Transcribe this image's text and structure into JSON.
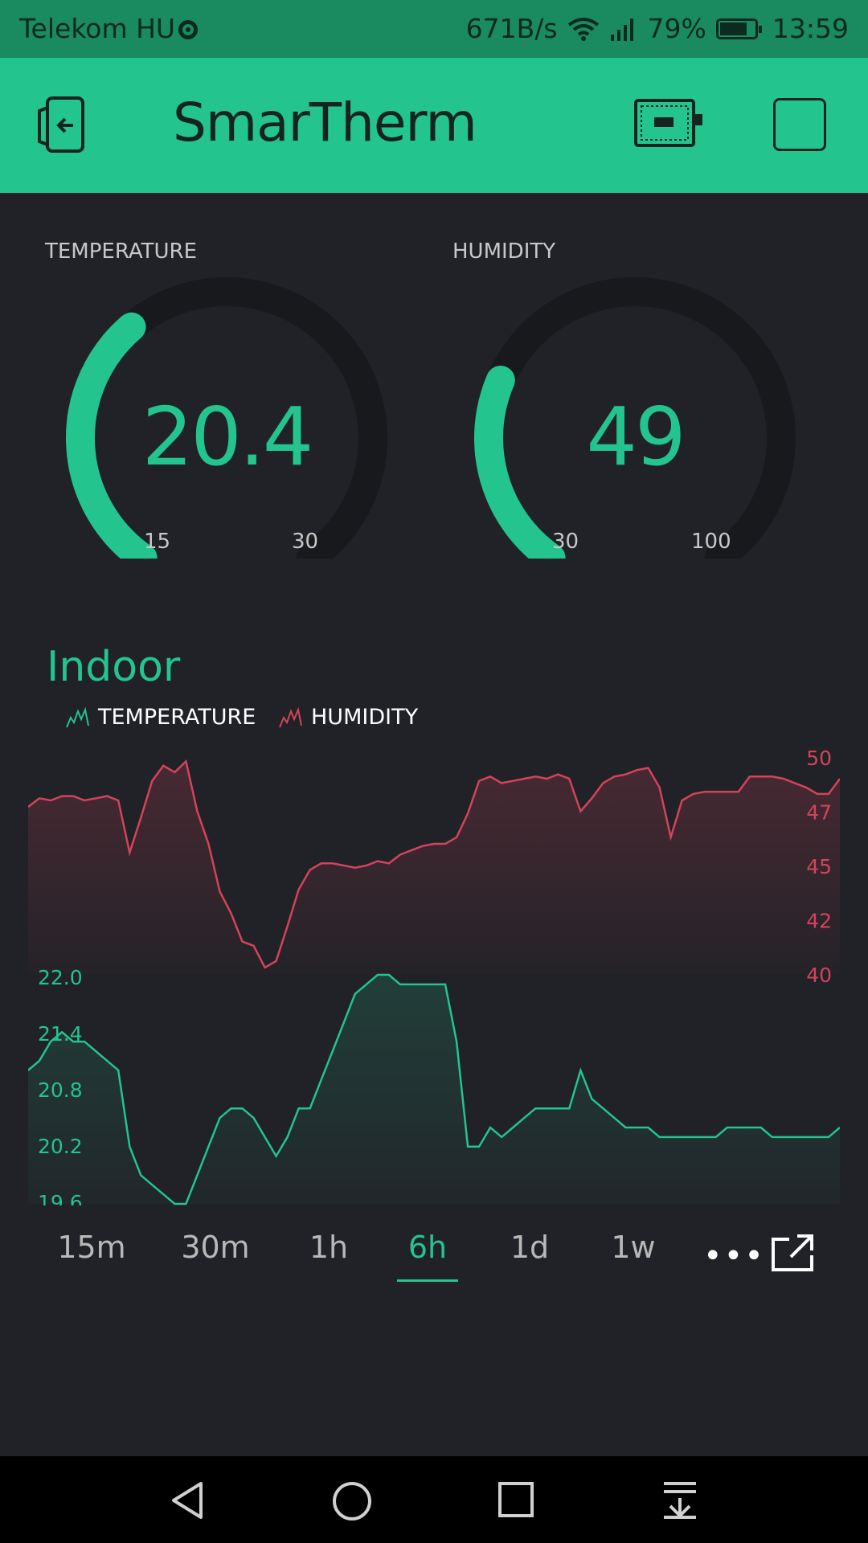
{
  "status_bar": {
    "carrier": "Telekom HU",
    "speed": "671B/s",
    "battery": "79%",
    "battery_level": 0.79,
    "time": "13:59"
  },
  "app": {
    "title": "SmarTherm",
    "icons": [
      "exit-icon",
      "device-icon",
      "square-icon"
    ]
  },
  "gauges": [
    {
      "label": "TEMPERATURE",
      "value": "20.4",
      "min": "15",
      "max": "30",
      "fraction": 0.36
    },
    {
      "label": "HUMIDITY",
      "value": "49",
      "min": "30",
      "max": "100",
      "fraction": 0.27
    }
  ],
  "chart": {
    "title": "Indoor",
    "legend": [
      "TEMPERATURE",
      "HUMIDITY"
    ]
  },
  "chart_data": {
    "type": "line",
    "title": "Indoor",
    "series": [
      {
        "name": "TEMPERATURE",
        "color": "#23c48e",
        "axis": "left",
        "ylim": [
          19.6,
          22.0
        ],
        "ticks": [
          "22.0",
          "21.4",
          "20.8",
          "20.2",
          "19.6"
        ],
        "values": [
          21.0,
          21.1,
          21.3,
          21.4,
          21.3,
          21.3,
          21.2,
          21.1,
          21.0,
          20.2,
          19.9,
          19.8,
          19.7,
          19.6,
          19.6,
          19.9,
          20.2,
          20.5,
          20.6,
          20.6,
          20.5,
          20.3,
          20.1,
          20.3,
          20.6,
          20.6,
          20.9,
          21.2,
          21.5,
          21.8,
          21.9,
          22.0,
          22.0,
          21.9,
          21.9,
          21.9,
          21.9,
          21.9,
          21.3,
          20.2,
          20.2,
          20.4,
          20.3,
          20.4,
          20.5,
          20.6,
          20.6,
          20.6,
          20.6,
          21.0,
          20.7,
          20.6,
          20.5,
          20.4,
          20.4,
          20.4,
          20.3,
          20.3,
          20.3,
          20.3,
          20.3,
          20.3,
          20.4,
          20.4,
          20.4,
          20.4,
          20.3,
          20.3,
          20.3,
          20.3,
          20.3,
          20.3,
          20.4
        ]
      },
      {
        "name": "HUMIDITY",
        "color": "#d3435c",
        "axis": "right",
        "ylim": [
          40,
          50
        ],
        "ticks": [
          "50",
          "47",
          "45",
          "42",
          "40"
        ],
        "values": [
          47.7,
          48.1,
          48.0,
          48.2,
          48.2,
          48.0,
          48.1,
          48.2,
          48.0,
          45.6,
          47.2,
          48.9,
          49.6,
          49.3,
          49.8,
          47.5,
          46.0,
          43.8,
          42.8,
          41.5,
          41.3,
          40.3,
          40.6,
          42.2,
          43.9,
          44.8,
          45.1,
          45.1,
          45.0,
          44.9,
          45.0,
          45.2,
          45.1,
          45.5,
          45.7,
          45.9,
          46.0,
          46.0,
          46.3,
          47.4,
          48.9,
          49.1,
          48.8,
          48.9,
          49.0,
          49.1,
          49.0,
          49.2,
          49.0,
          47.5,
          48.1,
          48.8,
          49.1,
          49.2,
          49.4,
          49.5,
          48.6,
          46.3,
          48.0,
          48.3,
          48.4,
          48.4,
          48.4,
          48.4,
          49.1,
          49.1,
          49.1,
          49.0,
          48.8,
          48.6,
          48.3,
          48.3,
          49.0
        ]
      }
    ]
  },
  "time_ranges": {
    "items": [
      "15m",
      "30m",
      "1h",
      "6h",
      "1d",
      "1w"
    ],
    "active": "6h",
    "more": "•••"
  }
}
